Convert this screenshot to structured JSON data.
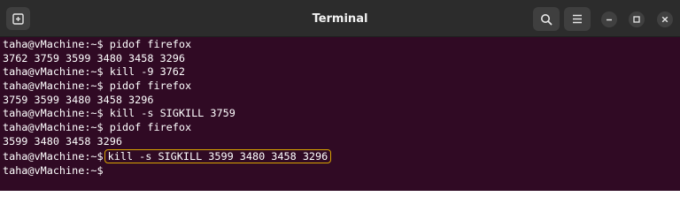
{
  "window": {
    "title": "Terminal"
  },
  "icons": {
    "new_tab": "new-tab-icon",
    "search": "search-icon",
    "menu": "hamburger-menu-icon",
    "minimize": "minimize-icon",
    "maximize": "maximize-icon",
    "close": "close-icon"
  },
  "colors": {
    "terminal_bg": "#300a24",
    "titlebar_bg": "#2c2c2c",
    "highlight_border": "#d9a400",
    "text": "#ffffff"
  },
  "terminal": {
    "lines": [
      {
        "prompt": "taha@vMachine:~$",
        "command": "pidof firefox"
      },
      {
        "output": "3762 3759 3599 3480 3458 3296"
      },
      {
        "prompt": "taha@vMachine:~$",
        "command": "kill -9 3762"
      },
      {
        "prompt": "taha@vMachine:~$",
        "command": "pidof firefox"
      },
      {
        "output": "3759 3599 3480 3458 3296"
      },
      {
        "prompt": "taha@vMachine:~$",
        "command": "kill -s SIGKILL 3759"
      },
      {
        "prompt": "taha@vMachine:~$",
        "command": "pidof firefox"
      },
      {
        "output": "3599 3480 3458 3296"
      },
      {
        "prompt": "taha@vMachine:~$",
        "command": "kill -s SIGKILL 3599 3480 3458 3296",
        "highlighted": true
      },
      {
        "prompt": "taha@vMachine:~$",
        "command": ""
      }
    ]
  }
}
